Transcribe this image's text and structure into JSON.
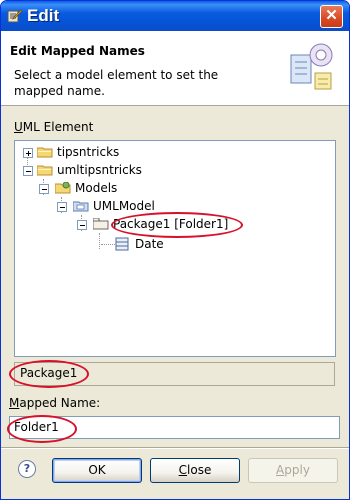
{
  "window": {
    "title": "Edit",
    "close_glyph": "✕",
    "title_icon": "edit-window-icon"
  },
  "banner": {
    "title": "Edit Mapped Names",
    "message": "Select a model element to set the mapped name.",
    "icon": "mapping-wizard-icon"
  },
  "tree_section": {
    "label_prefix": "U",
    "label_rest": "ML Element"
  },
  "tree": {
    "nodes": [
      {
        "label": "tipsntricks",
        "icon": "project-folder-icon",
        "expander": "collapsed"
      },
      {
        "label": "umltipsntricks",
        "icon": "project-folder-icon",
        "expander": "expanded"
      },
      {
        "label": "Models",
        "icon": "models-folder-icon",
        "expander": "expanded"
      },
      {
        "label": "UMLModel",
        "icon": "uml-model-icon",
        "expander": "expanded"
      },
      {
        "label": "Package1 [Folder1]",
        "icon": "package-icon",
        "expander": "expanded"
      },
      {
        "label": "Date",
        "icon": "class-icon",
        "expander": "none"
      }
    ]
  },
  "selected_element": {
    "value": "Package1"
  },
  "mapped_name": {
    "label_prefix": "M",
    "label_rest": "apped Name:",
    "value": "Folder1"
  },
  "buttons": {
    "help": "?",
    "ok": "OK",
    "close_prefix": "C",
    "close_rest": "lose",
    "apply_prefix": "A",
    "apply_rest": "pply"
  },
  "colors": {
    "highlight_ellipse": "#d8102a",
    "titlebar": "#0a5ae0"
  }
}
